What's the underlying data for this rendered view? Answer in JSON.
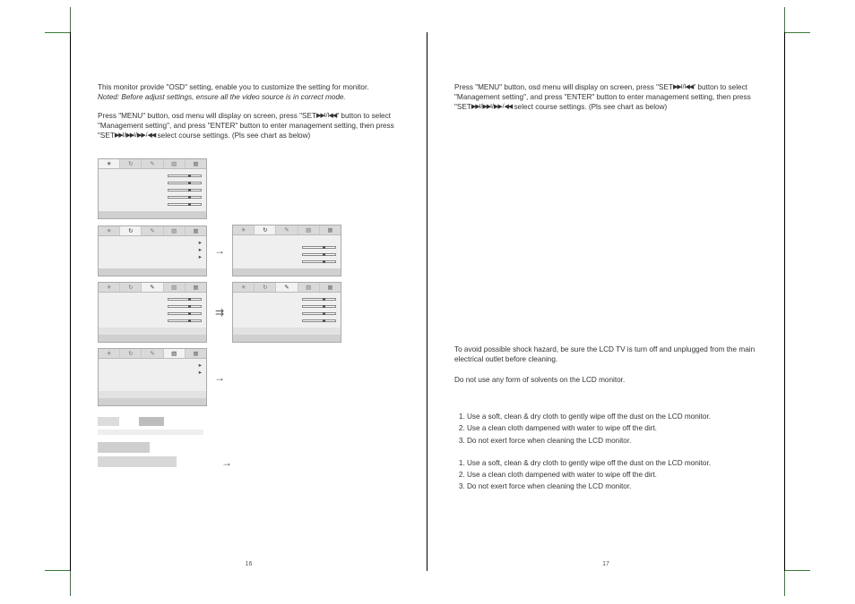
{
  "leftPage": {
    "intro": "This monitor provide \"OSD\" setting, enable you to customize the setting for monitor.",
    "noted": "Noted: Before adjust settings, ensure all the video source is in correct mode.",
    "instr1a": "Press \"MENU\" button, osd menu will display on screen, press \"SET",
    "instr1b": "\" button to select \"Management setting\", and press \"ENTER\" button to enter management setting, then press \"SET",
    "instr1c": " select course settings. (Pls see chart as below)",
    "transport1": "▶▶I / I◀◀",
    "transport2": "▶▶I / ▶▶I / ▶▶ / ◀◀",
    "pageNum": "16"
  },
  "rightPage": {
    "instr1a": "Press \"MENU\" button, osd menu will display on screen, press \"SET",
    "instr1b": "\" button to select \"Management setting\", and press \"ENTER\" button to enter management setting, then press \"SET",
    "instr1c": " select course settings. (Pls see chart as below)",
    "transport1": "▶▶I / I◀◀",
    "transport2": "▶▶I / ▶▶I / ▶▶ / ◀◀",
    "warn1": "To avoid possible shock hazard, be sure the LCD TV is turn off and unplugged from the main electrical outlet before cleaning.",
    "warn2": "Do not use any form of solvents on the LCD monitor.",
    "list": [
      "Use a soft, clean & dry cloth to gently wipe off the dust on the LCD monitor.",
      "Use a clean cloth dampened with water to wipe off the dirt.",
      "Do not exert force when cleaning the LCD monitor."
    ],
    "pageNum": "17"
  },
  "osdIcons": [
    "☀",
    "↻",
    "✎",
    "▧",
    "▦"
  ]
}
